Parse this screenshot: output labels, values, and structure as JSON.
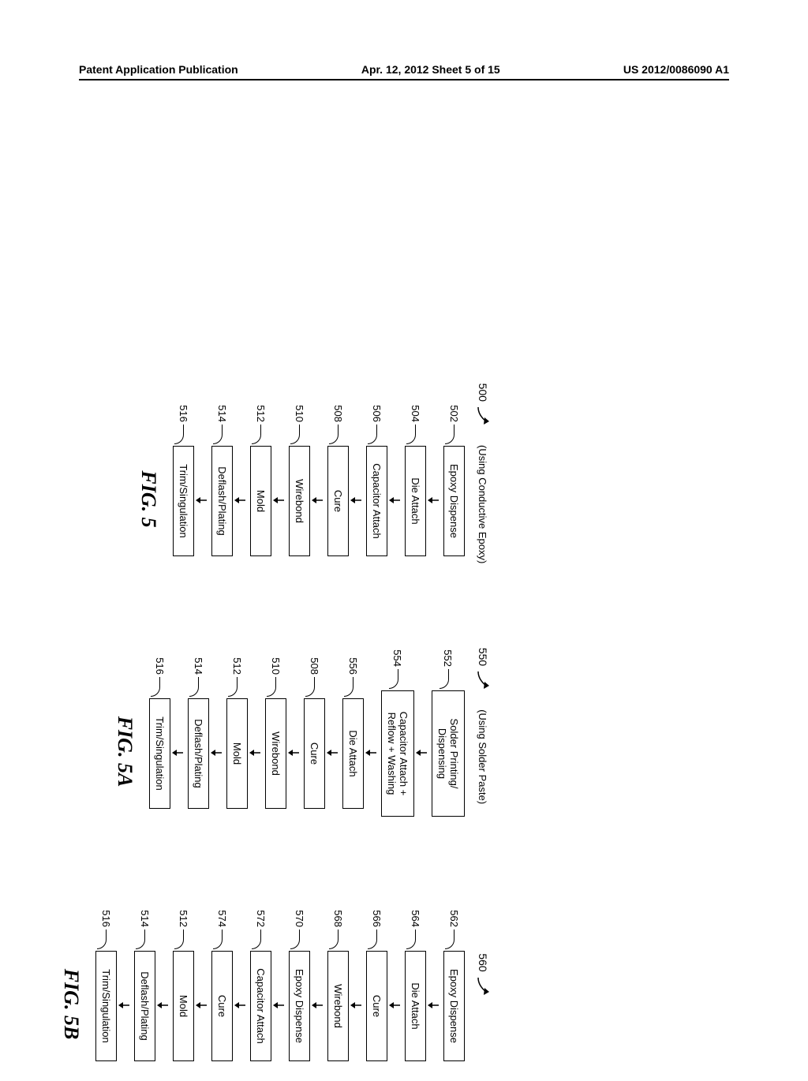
{
  "header": {
    "left": "Patent Application Publication",
    "center": "Apr. 12, 2012  Sheet 5 of 15",
    "right": "US 2012/0086090 A1"
  },
  "flowcharts": [
    {
      "ref": "500",
      "subtitle": "(Using Conductive Epoxy)",
      "fig_label": "FIG. 5",
      "steps": [
        {
          "ref": "502",
          "label": "Epoxy Dispense"
        },
        {
          "ref": "504",
          "label": "Die Attach"
        },
        {
          "ref": "506",
          "label": "Capacitor Attach"
        },
        {
          "ref": "508",
          "label": "Cure"
        },
        {
          "ref": "510",
          "label": "Wirebond"
        },
        {
          "ref": "512",
          "label": "Mold"
        },
        {
          "ref": "514",
          "label": "Deflash/Plating"
        },
        {
          "ref": "516",
          "label": "Trim/Singulation"
        }
      ]
    },
    {
      "ref": "550",
      "subtitle": "(Using Solder Paste)",
      "fig_label": "FIG. 5A",
      "steps": [
        {
          "ref": "552",
          "label": "Solder Printing/\nDispensing",
          "multiline": true
        },
        {
          "ref": "554",
          "label": "Capacitor Attach +\nReflow + Washing",
          "multiline": true
        },
        {
          "ref": "556",
          "label": "Die Attach"
        },
        {
          "ref": "508",
          "label": "Cure"
        },
        {
          "ref": "510",
          "label": "Wirebond"
        },
        {
          "ref": "512",
          "label": "Mold"
        },
        {
          "ref": "514",
          "label": "Deflash/Plating"
        },
        {
          "ref": "516",
          "label": "Trim/Singulation"
        }
      ]
    },
    {
      "ref": "560",
      "subtitle": "",
      "fig_label": "FIG. 5B",
      "steps": [
        {
          "ref": "562",
          "label": "Epoxy Dispense"
        },
        {
          "ref": "564",
          "label": "Die Attach"
        },
        {
          "ref": "566",
          "label": "Cure"
        },
        {
          "ref": "568",
          "label": "Wirebond"
        },
        {
          "ref": "570",
          "label": "Epoxy Dispense"
        },
        {
          "ref": "572",
          "label": "Capacitor Attach"
        },
        {
          "ref": "574",
          "label": "Cure"
        },
        {
          "ref": "512",
          "label": "Mold"
        },
        {
          "ref": "514",
          "label": "Deflash/Plating"
        },
        {
          "ref": "516",
          "label": "Trim/Singulation"
        }
      ]
    }
  ]
}
